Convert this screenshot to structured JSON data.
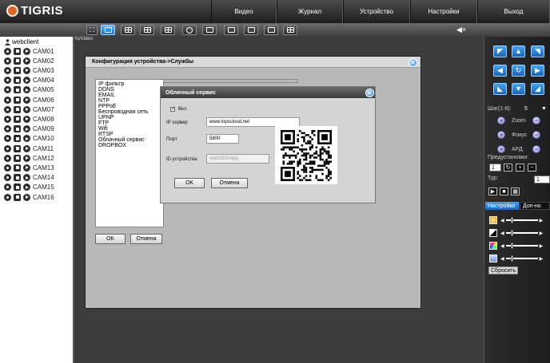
{
  "app": {
    "logo": "TIGRIS"
  },
  "nav": {
    "video": "Видео",
    "journal": "Журнал",
    "device": "Устройство",
    "settings": "Настройки",
    "exit": "Выход"
  },
  "sidebar": {
    "root": "webclient",
    "cameras": [
      "CAM01",
      "CAM02",
      "CAM03",
      "CAM04",
      "CAM05",
      "CAM06",
      "CAM07",
      "CAM08",
      "CAM09",
      "CAM10",
      "CAM11",
      "CAM12",
      "CAM13",
      "CAM14",
      "CAM15",
      "CAM16"
    ]
  },
  "main": {
    "tab_label": "fo/Video"
  },
  "config": {
    "title": "Конфигурация устройства->Службы",
    "services": [
      "IP фильтр",
      "DDNS",
      "EMAIL",
      "NTP",
      "PPPoE",
      "Беспроводная сеть",
      "UPNP",
      "FTP",
      "Wifi",
      "RTSP",
      "Облачный сервис",
      "DROPBOX"
    ],
    "ok": "OK",
    "cancel": "Отмена"
  },
  "cloud": {
    "title": "Облачный сервис",
    "enable_label": "Вкл.",
    "enable_checked": true,
    "ip_label": "IP сервер",
    "ip_value": "www.topscloud.net",
    "port_label": "Порт",
    "port_value": "5800",
    "id_label": "ID устройства",
    "id_value": "wjetzOiOnlqq",
    "ok": "OK",
    "cancel": "Отмена"
  },
  "ptz": {
    "step_label": "Шаг(1-8):",
    "step_value": "5",
    "zoom": "Zoom",
    "focus": "Фокус",
    "iris": "АРД",
    "presets": "Предустановки:",
    "preset_value": "1",
    "tour": "Тур:",
    "tour_value": "1",
    "tab_settings": "Настройки",
    "tab_extra": "Доп-но",
    "reset": "Сбросить",
    "colors": {
      "accent": "#1e7ad6",
      "active": "#3ea0f5"
    }
  }
}
